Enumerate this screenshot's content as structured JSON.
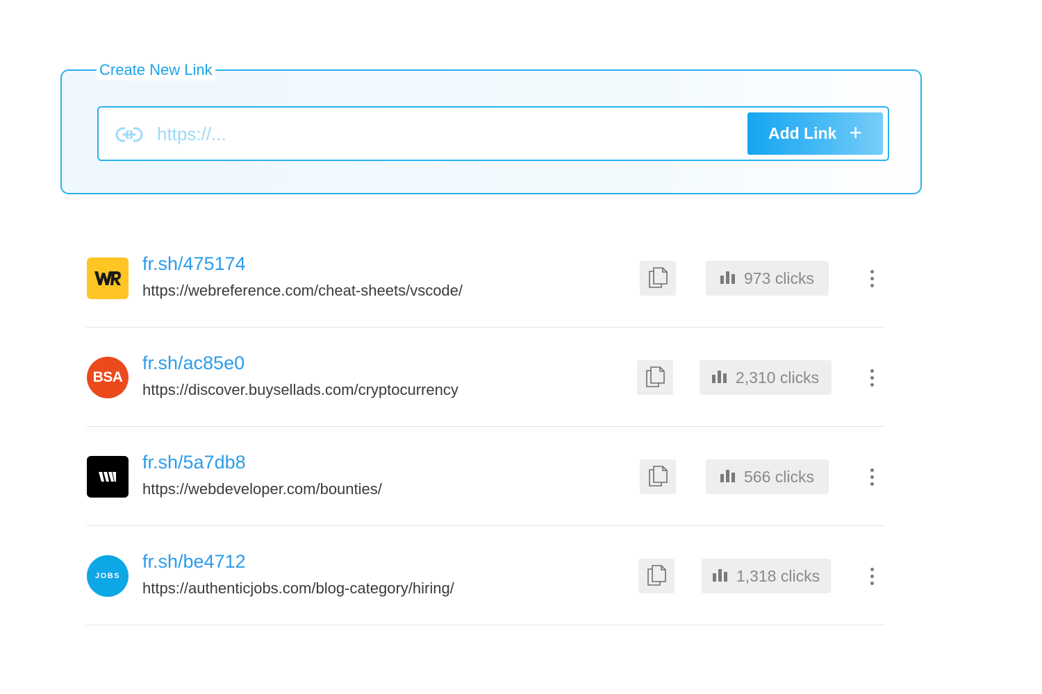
{
  "create_panel": {
    "legend": "Create New Link",
    "input_placeholder": "https://...",
    "input_value": "",
    "add_button_label": "Add Link",
    "add_button_icon": "plus-icon",
    "input_icon": "link-icon"
  },
  "colors": {
    "accent": "#1ea4e8",
    "short_link": "#2b9cea",
    "badge_bg": "#eeeeee"
  },
  "links": [
    {
      "short": "fr.sh/475174",
      "url": "https://webreference.com/cheat-sheets/vscode/",
      "clicks": "973 clicks",
      "logo_text": "WR",
      "logo_bg": "#ffc524",
      "logo_fg": "#1a1a1a",
      "logo_shape": "square"
    },
    {
      "short": "fr.sh/ac85e0",
      "url": "https://discover.buysellads.com/cryptocurrency",
      "clicks": "2,310 clicks",
      "logo_text": "BSA",
      "logo_bg": "#eb4a1c",
      "logo_fg": "#ffffff",
      "logo_shape": "circle"
    },
    {
      "short": "fr.sh/5a7db8",
      "url": "https://webdeveloper.com/bounties/",
      "clicks": "566 clicks",
      "logo_text": "W",
      "logo_bg": "#000000",
      "logo_fg": "#ffffff",
      "logo_shape": "square"
    },
    {
      "short": "fr.sh/be4712",
      "url": "https://authenticjobs.com/blog-category/hiring/",
      "clicks": "1,318 clicks",
      "logo_text": "JOBS",
      "logo_bg": "#0ea7e6",
      "logo_fg": "#ffffff",
      "logo_shape": "circle"
    }
  ]
}
